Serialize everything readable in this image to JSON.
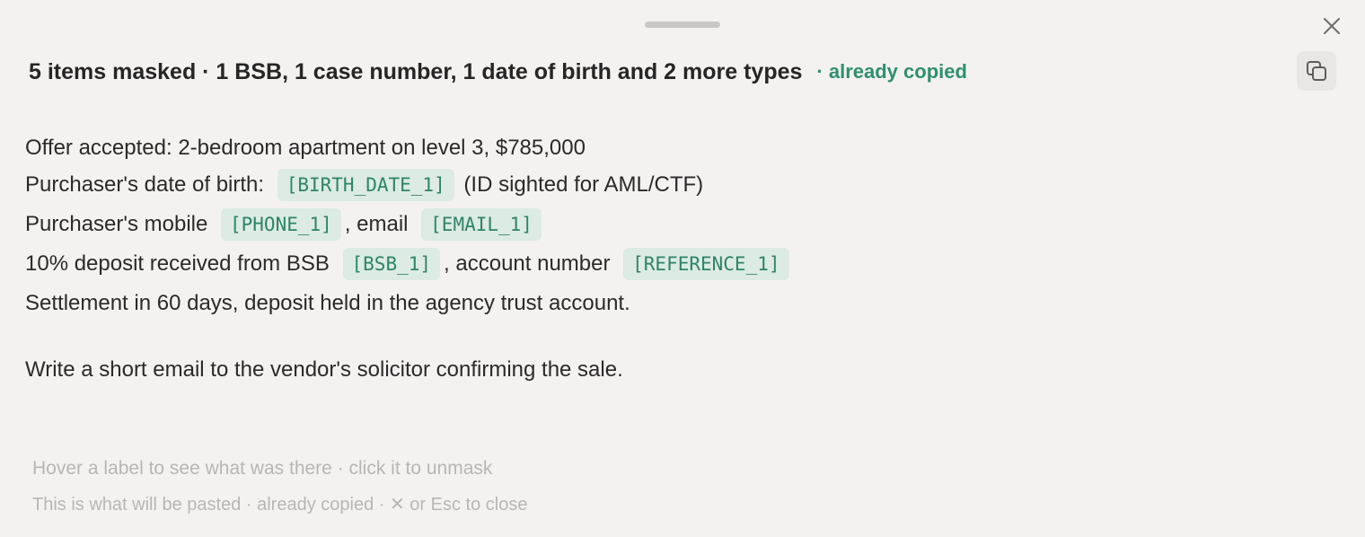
{
  "header": {
    "title": "5 items masked · 1 BSB, 1 case number, 1 date of birth and 2 more types",
    "status": "· already copied"
  },
  "icons": {
    "close": "close-icon",
    "copy": "copy-icon",
    "drag": "drag-handle"
  },
  "colors": {
    "accent": "#2f8f6f",
    "tag_background": "#dcebe4",
    "tag_text": "#2f8468",
    "background": "#f4f2f1"
  },
  "content": {
    "line1": "Offer accepted: 2-bedroom apartment on level 3, $785,000",
    "line2": {
      "before": "Purchaser's date of birth: ",
      "tag": "[BIRTH_DATE_1]",
      "after": " (ID sighted for AML/CTF)"
    },
    "line3": {
      "before": "Purchaser's mobile ",
      "tag1": "[PHONE_1]",
      "middle": ", email ",
      "tag2": "[EMAIL_1]"
    },
    "line4": {
      "before": "10% deposit received from BSB ",
      "tag1": "[BSB_1]",
      "middle": ", account number ",
      "tag2": "[REFERENCE_1]"
    },
    "line5": "Settlement in 60 days, deposit held in the agency trust account.",
    "line6": "Write a short email to the vendor's solicitor confirming the sale."
  },
  "footer": {
    "hint": "Hover a label to see what was there · click it to unmask",
    "info": "This is what will be pasted · already copied · ✕ or Esc to close"
  }
}
